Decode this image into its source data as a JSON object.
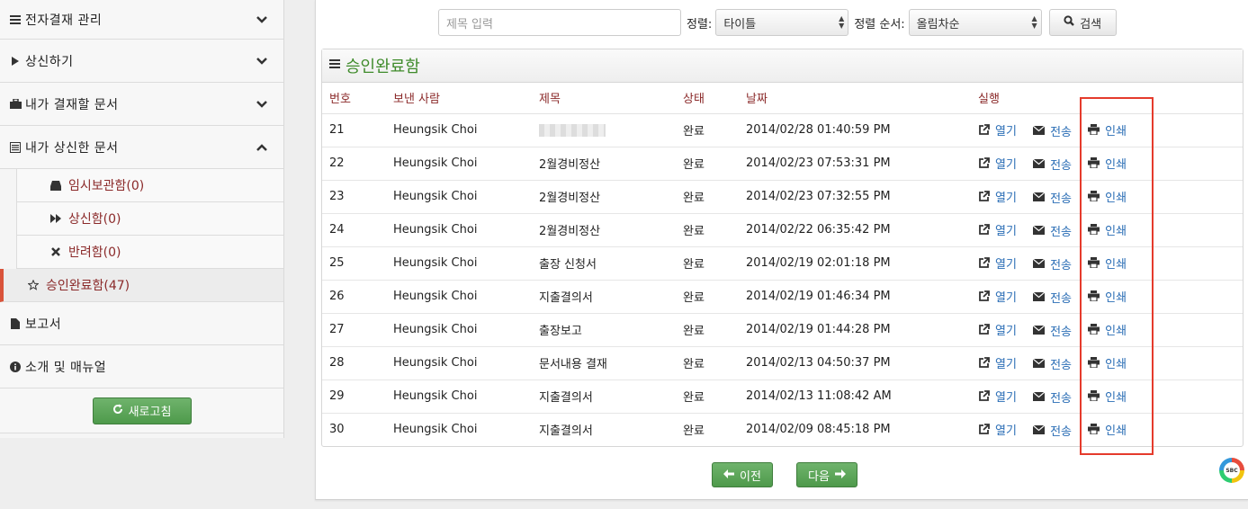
{
  "sidebar": {
    "groups": [
      {
        "label": "전자결재 관리",
        "icon": "list-icon"
      },
      {
        "label": "상신하기",
        "icon": "play-icon"
      },
      {
        "label": "내가 결재할 문서",
        "icon": "briefcase-icon"
      },
      {
        "label": "내가 상신한 문서",
        "icon": "document-list-icon"
      }
    ],
    "subitems": [
      {
        "label": "임시보관함(0)",
        "icon": "inbox-icon"
      },
      {
        "label": "상신함(0)",
        "icon": "fast-forward-icon"
      },
      {
        "label": "반려함(0)",
        "icon": "x-icon"
      },
      {
        "label": "승인완료함(47)",
        "icon": "star-icon"
      }
    ],
    "report": {
      "label": "보고서"
    },
    "about": {
      "label": "소개 및 매뉴얼"
    },
    "refresh_label": "새로고침"
  },
  "search": {
    "placeholder": "제목 입력",
    "sort_label": "정렬:",
    "sort_value": "타이틀",
    "order_label": "정렬 순서:",
    "order_value": "올림차순",
    "button_label": "검색"
  },
  "panel": {
    "title": "승인완료함"
  },
  "table": {
    "headers": [
      "번호",
      "보낸 사람",
      "제목",
      "상태",
      "날짜",
      "실행"
    ],
    "actions": {
      "open": "열기",
      "send": "전송",
      "print": "인쇄"
    },
    "rows": [
      {
        "no": "21",
        "sender": "Heungsik Choi",
        "title": "",
        "status": "완료",
        "date": "2014/02/28 01:40:59 PM"
      },
      {
        "no": "22",
        "sender": "Heungsik Choi",
        "title": "2월경비정산",
        "status": "완료",
        "date": "2014/02/23 07:53:31 PM"
      },
      {
        "no": "23",
        "sender": "Heungsik Choi",
        "title": "2월경비정산",
        "status": "완료",
        "date": "2014/02/23 07:32:55 PM"
      },
      {
        "no": "24",
        "sender": "Heungsik Choi",
        "title": "2월경비정산",
        "status": "완료",
        "date": "2014/02/22 06:35:42 PM"
      },
      {
        "no": "25",
        "sender": "Heungsik Choi",
        "title": "출장 신청서",
        "status": "완료",
        "date": "2014/02/19 02:01:18 PM"
      },
      {
        "no": "26",
        "sender": "Heungsik Choi",
        "title": "지출결의서",
        "status": "완료",
        "date": "2014/02/19 01:46:34 PM"
      },
      {
        "no": "27",
        "sender": "Heungsik Choi",
        "title": "출장보고",
        "status": "완료",
        "date": "2014/02/19 01:44:28 PM"
      },
      {
        "no": "28",
        "sender": "Heungsik Choi",
        "title": "문서내용 결재",
        "status": "완료",
        "date": "2014/02/13 04:50:37 PM"
      },
      {
        "no": "29",
        "sender": "Heungsik Choi",
        "title": "지출결의서",
        "status": "완료",
        "date": "2014/02/13 11:08:42 AM"
      },
      {
        "no": "30",
        "sender": "Heungsik Choi",
        "title": "지출결의서",
        "status": "완료",
        "date": "2014/02/09 08:45:18 PM"
      }
    ]
  },
  "pager": {
    "prev_label": "이전",
    "next_label": "다음"
  },
  "logo": {
    "text": "SBC"
  }
}
